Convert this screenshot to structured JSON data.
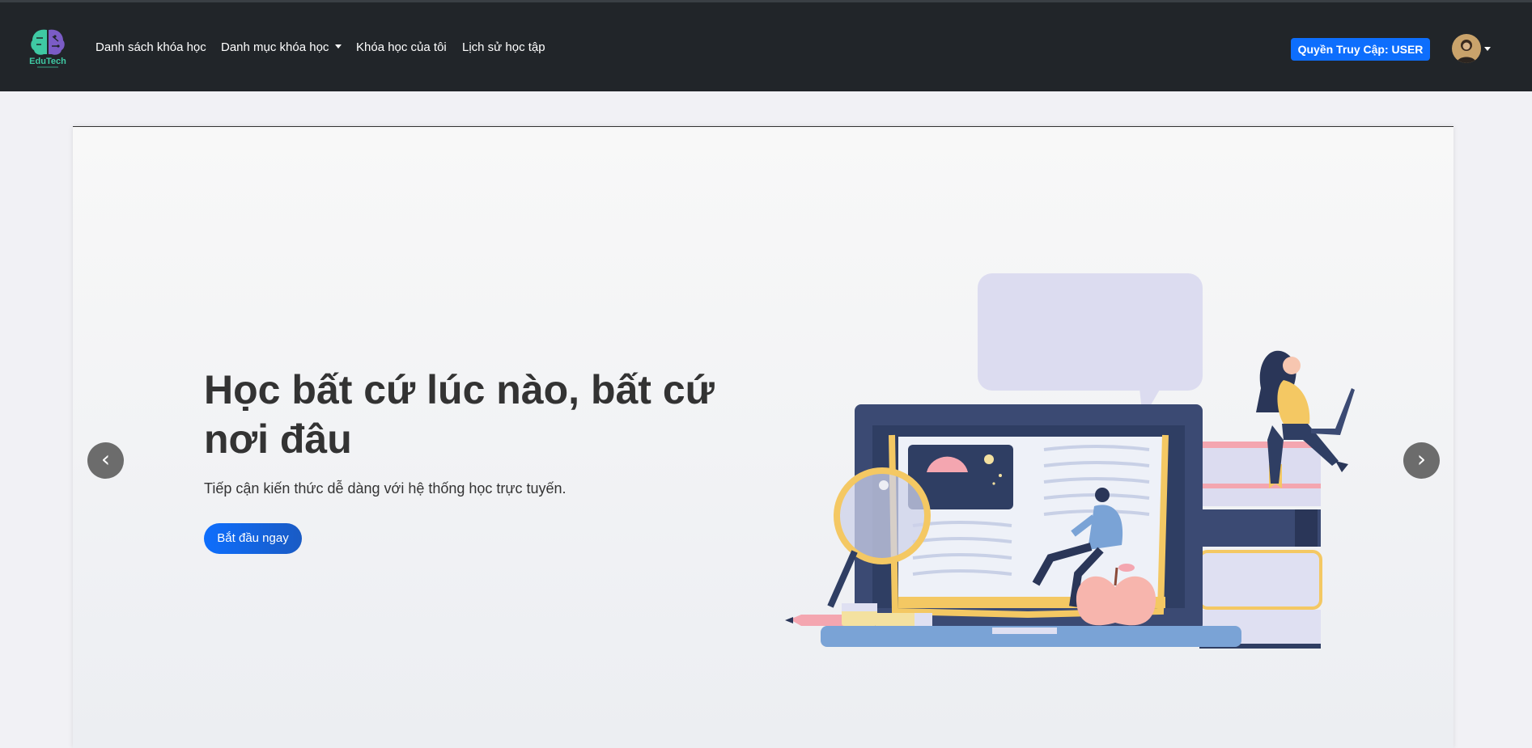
{
  "navbar": {
    "logo_text": "EduTech",
    "links": [
      "Danh sách khóa học",
      "Danh mục khóa học",
      "Khóa học của tôi",
      "Lịch sử học tập"
    ],
    "access_button": "Quyền Truy Cập: USER"
  },
  "hero": {
    "title": "Học bất cứ lúc nào, bất cứ nơi đâu",
    "subtitle": "Tiếp cận kiến thức dễ dàng với hệ thống học trực tuyến.",
    "cta": "Bắt đầu ngay"
  },
  "carousel": {
    "prev": "‹",
    "next": "›"
  },
  "icons": {
    "logo": "brain-logo-icon",
    "dropdown": "caret-down-icon",
    "avatar": "user-avatar-icon",
    "illustration": "online-learning-illustration"
  },
  "colors": {
    "navbar": "#212529",
    "primary": "#0d6efd",
    "text": "#333333"
  }
}
